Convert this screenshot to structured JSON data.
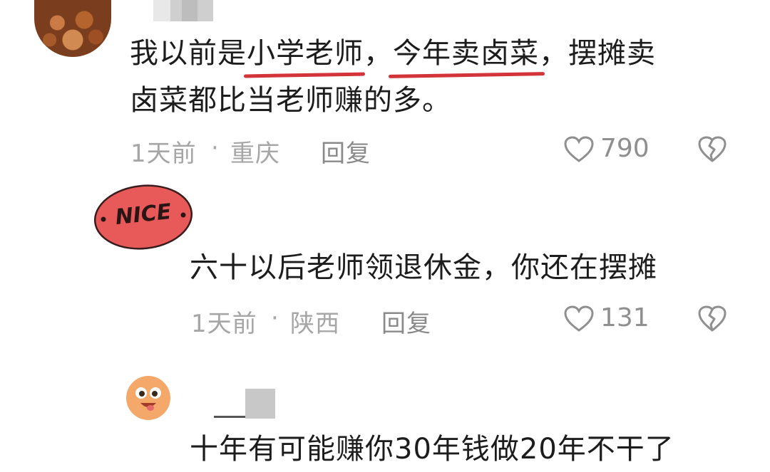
{
  "comments": [
    {
      "text_line1_a": "我以前是",
      "highlight1": "小学老师",
      "comma1": "，",
      "highlight2": "今年卖卤菜",
      "comma2": "，",
      "text_line1_b": "摆摊卖",
      "text_line2": "卤菜都比当老师赚的多。",
      "time": "1天前",
      "location": "重庆",
      "reply_label": "回复",
      "likes": "790"
    },
    {
      "badge_text": "NICE",
      "text": "六十以后老师领退休金，你还在摆摊",
      "time": "1天前",
      "location": "陕西",
      "reply_label": "回复",
      "likes": "131"
    },
    {
      "text": "十年有可能赚你30年钱做20年不干了"
    }
  ],
  "meta_separator": "·",
  "colors": {
    "highlight_underline": "#d2343a",
    "badge_fill": "#e85a5a",
    "text": "#1c1c1c",
    "meta": "#a6a6a6"
  },
  "icons": {
    "like": "heart-outline-icon",
    "dislike": "broken-heart-icon"
  }
}
